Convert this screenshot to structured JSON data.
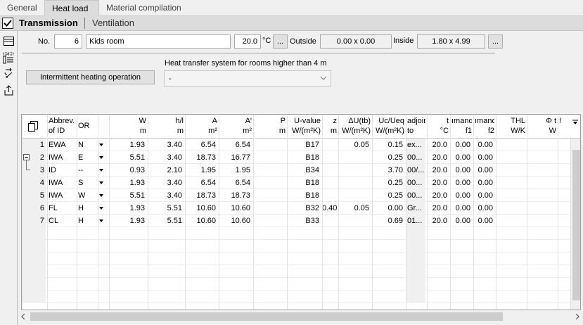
{
  "tabs": [
    {
      "label": "General"
    },
    {
      "label": "Heat load"
    },
    {
      "label": "Material compilation"
    }
  ],
  "section": {
    "title": "Transmission",
    "secondary": "Ventilation"
  },
  "room": {
    "no_label": "No.",
    "no_value": "6",
    "name": "Kids room",
    "temp": "20.0",
    "unit": "°C",
    "ellipsis": "...",
    "outside_label": "Outside",
    "outside_value": "0.00 x 0.00",
    "inside_label": "Inside",
    "inside_value": "1.80 x 4.99"
  },
  "intermittent_label": "Intermittent heating operation",
  "hts": {
    "label": "Heat transfer system for rooms higher than 4 m",
    "value": "-"
  },
  "headers": {
    "abbrev": [
      "Abbrev.",
      "of ID"
    ],
    "or": [
      "OR",
      ""
    ],
    "w": [
      "W",
      "m"
    ],
    "h": [
      "h/l",
      "m"
    ],
    "a": [
      "A",
      "m²"
    ],
    "ap": [
      "A'",
      "m²"
    ],
    "p": [
      "P",
      "m"
    ],
    "u": [
      "U-value",
      "W/(m²K)"
    ],
    "z": [
      "z",
      "m"
    ],
    "du": [
      "ΔU(tb)",
      "W/(m²K)"
    ],
    "uc": [
      "Uc/Ueq",
      "W/(m²K)"
    ],
    "adj": [
      "adjoin",
      "to"
    ],
    "t": [
      "t",
      "°C"
    ],
    "f1": [
      "ımand",
      "f1"
    ],
    "f2": [
      "ımand",
      "f2"
    ],
    "thl": [
      "THL",
      "W/K"
    ],
    "phi": [
      "Φ t",
      "W"
    ],
    "ex": [
      "!",
      ""
    ]
  },
  "rows": [
    {
      "n": "1",
      "id": "EWA",
      "or": "N",
      "w": "1.93",
      "h": "3.40",
      "a": "6.54",
      "ap": "6.54",
      "p": "",
      "u": "B17",
      "z": "",
      "du": "0.05",
      "uc": "0.15",
      "adj": "ex...",
      "t": "20.0",
      "f1": "0.00",
      "f2": "0.00"
    },
    {
      "n": "2",
      "id": "IWA",
      "or": "E",
      "w": "5.51",
      "h": "3.40",
      "a": "18.73",
      "ap": "16.77",
      "p": "",
      "u": "B18",
      "z": "",
      "du": "",
      "uc": "0.25",
      "adj": "00...",
      "t": "20.0",
      "f1": "0.00",
      "f2": "0.00"
    },
    {
      "n": "3",
      "id": "ID",
      "or": "--",
      "w": "0.93",
      "h": "2.10",
      "a": "1.95",
      "ap": "1.95",
      "p": "",
      "u": "B34",
      "z": "",
      "du": "",
      "uc": "3.70",
      "adj": "00/...",
      "t": "20.0",
      "f1": "0.00",
      "f2": "0.00"
    },
    {
      "n": "4",
      "id": "IWA",
      "or": "S",
      "w": "1.93",
      "h": "3.40",
      "a": "6.54",
      "ap": "6.54",
      "p": "",
      "u": "B18",
      "z": "",
      "du": "",
      "uc": "0.25",
      "adj": "00...",
      "t": "20.0",
      "f1": "0.00",
      "f2": "0.00"
    },
    {
      "n": "5",
      "id": "IWA",
      "or": "W",
      "w": "5.51",
      "h": "3.40",
      "a": "18.73",
      "ap": "18.73",
      "p": "",
      "u": "B18",
      "z": "",
      "du": "",
      "uc": "0.25",
      "adj": "00...",
      "t": "20.0",
      "f1": "0.00",
      "f2": "0.00"
    },
    {
      "n": "6",
      "id": "FL",
      "or": "H",
      "w": "1.93",
      "h": "5.51",
      "a": "10.60",
      "ap": "10.60",
      "p": "",
      "u": "B32",
      "z": "0.40",
      "du": "0.05",
      "uc": "0.00",
      "adj": "Gr...",
      "t": "20.0",
      "f1": "0.00",
      "f2": "0.00"
    },
    {
      "n": "7",
      "id": "CL",
      "or": "H",
      "w": "1.93",
      "h": "5.51",
      "a": "10.60",
      "ap": "10.60",
      "p": "",
      "u": "B33",
      "z": "",
      "du": "",
      "uc": "0.69",
      "adj": "01...",
      "t": "20.0",
      "f1": "0.00",
      "f2": "0.00"
    }
  ]
}
